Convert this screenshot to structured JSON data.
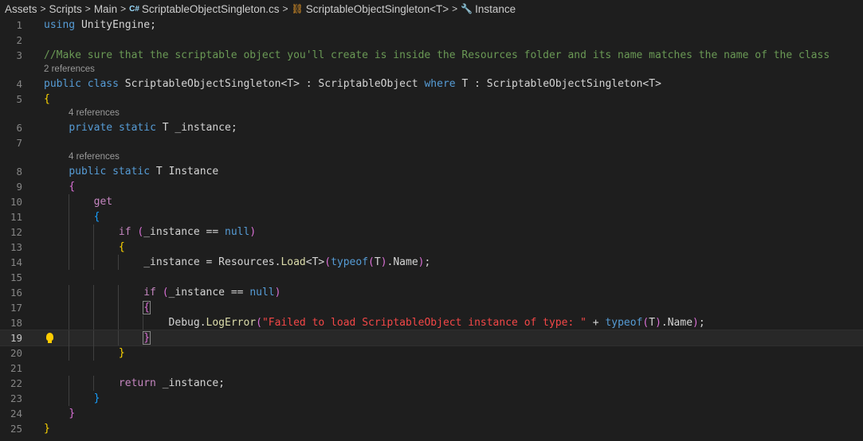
{
  "breadcrumb": {
    "items": [
      "Assets",
      "Scripts",
      "Main",
      "ScriptableObjectSingleton.cs",
      "ScriptableObjectSingleton<T>",
      "Instance"
    ],
    "separator": ">"
  },
  "editor": {
    "current_line": 19,
    "code_lens": {
      "line4": "2 references",
      "line6": "4 references",
      "line8": "4 references"
    },
    "lines": [
      {
        "n": "1",
        "text": "using UnityEngine;"
      },
      {
        "n": "2",
        "text": ""
      },
      {
        "n": "3",
        "text": "//Make sure that the scriptable object you'll create is inside the Resources folder and its name matches the name of the class"
      },
      {
        "n": "4",
        "text": "public class ScriptableObjectSingleton<T> : ScriptableObject where T : ScriptableObjectSingleton<T>"
      },
      {
        "n": "5",
        "text": "{"
      },
      {
        "n": "6",
        "text": "    private static T _instance;"
      },
      {
        "n": "7",
        "text": ""
      },
      {
        "n": "8",
        "text": "    public static T Instance"
      },
      {
        "n": "9",
        "text": "    {"
      },
      {
        "n": "10",
        "text": "        get"
      },
      {
        "n": "11",
        "text": "        {"
      },
      {
        "n": "12",
        "text": "            if (_instance == null)"
      },
      {
        "n": "13",
        "text": "            {"
      },
      {
        "n": "14",
        "text": "                _instance = Resources.Load<T>(typeof(T).Name);"
      },
      {
        "n": "15",
        "text": ""
      },
      {
        "n": "16",
        "text": "                if (_instance == null)"
      },
      {
        "n": "17",
        "text": "                {"
      },
      {
        "n": "18",
        "text": "                    Debug.LogError(\"Failed to load ScriptableObject instance of type: \" + typeof(T).Name);"
      },
      {
        "n": "19",
        "text": "                }"
      },
      {
        "n": "20",
        "text": "            }"
      },
      {
        "n": "21",
        "text": ""
      },
      {
        "n": "22",
        "text": "            return _instance;"
      },
      {
        "n": "23",
        "text": "        }"
      },
      {
        "n": "24",
        "text": "    }"
      },
      {
        "n": "25",
        "text": "}"
      }
    ]
  }
}
